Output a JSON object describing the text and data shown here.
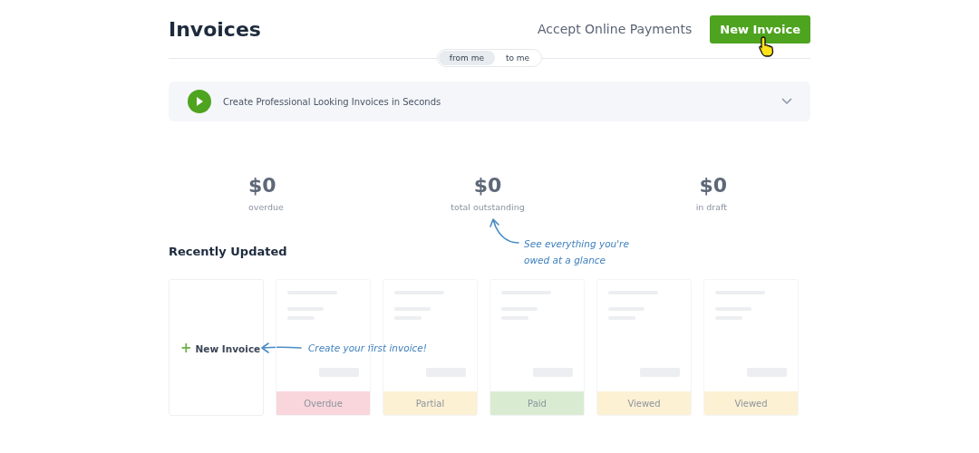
{
  "header": {
    "title": "Invoices",
    "link": "Accept Online Payments",
    "button": "New Invoice"
  },
  "toggle": [
    {
      "label": "from me",
      "selected": true
    },
    {
      "label": "to me",
      "selected": false
    }
  ],
  "banner": {
    "text": "Create Professional Looking Invoices in Seconds",
    "expanded": false
  },
  "stats": [
    {
      "amount": "$0",
      "label": "overdue"
    },
    {
      "amount": "$0",
      "label": "total outstanding"
    },
    {
      "amount": "$0",
      "label": "in draft"
    }
  ],
  "annotations": {
    "stats_note": [
      "See everything you're",
      "owed at a glance"
    ],
    "card_note": "Create your first invoice!"
  },
  "recent": {
    "title": "Recently Updated",
    "new_card": {
      "icon": "+",
      "label": "New Invoice"
    },
    "cards": [
      {
        "status": "Overdue",
        "color": "#f9d6dc"
      },
      {
        "status": "Partial",
        "color": "#fdf1d4"
      },
      {
        "status": "Paid",
        "color": "#d9ecd2"
      },
      {
        "status": "Viewed",
        "color": "#fdf1d4"
      },
      {
        "status": "Viewed",
        "color": "#fdf1d4"
      }
    ]
  }
}
